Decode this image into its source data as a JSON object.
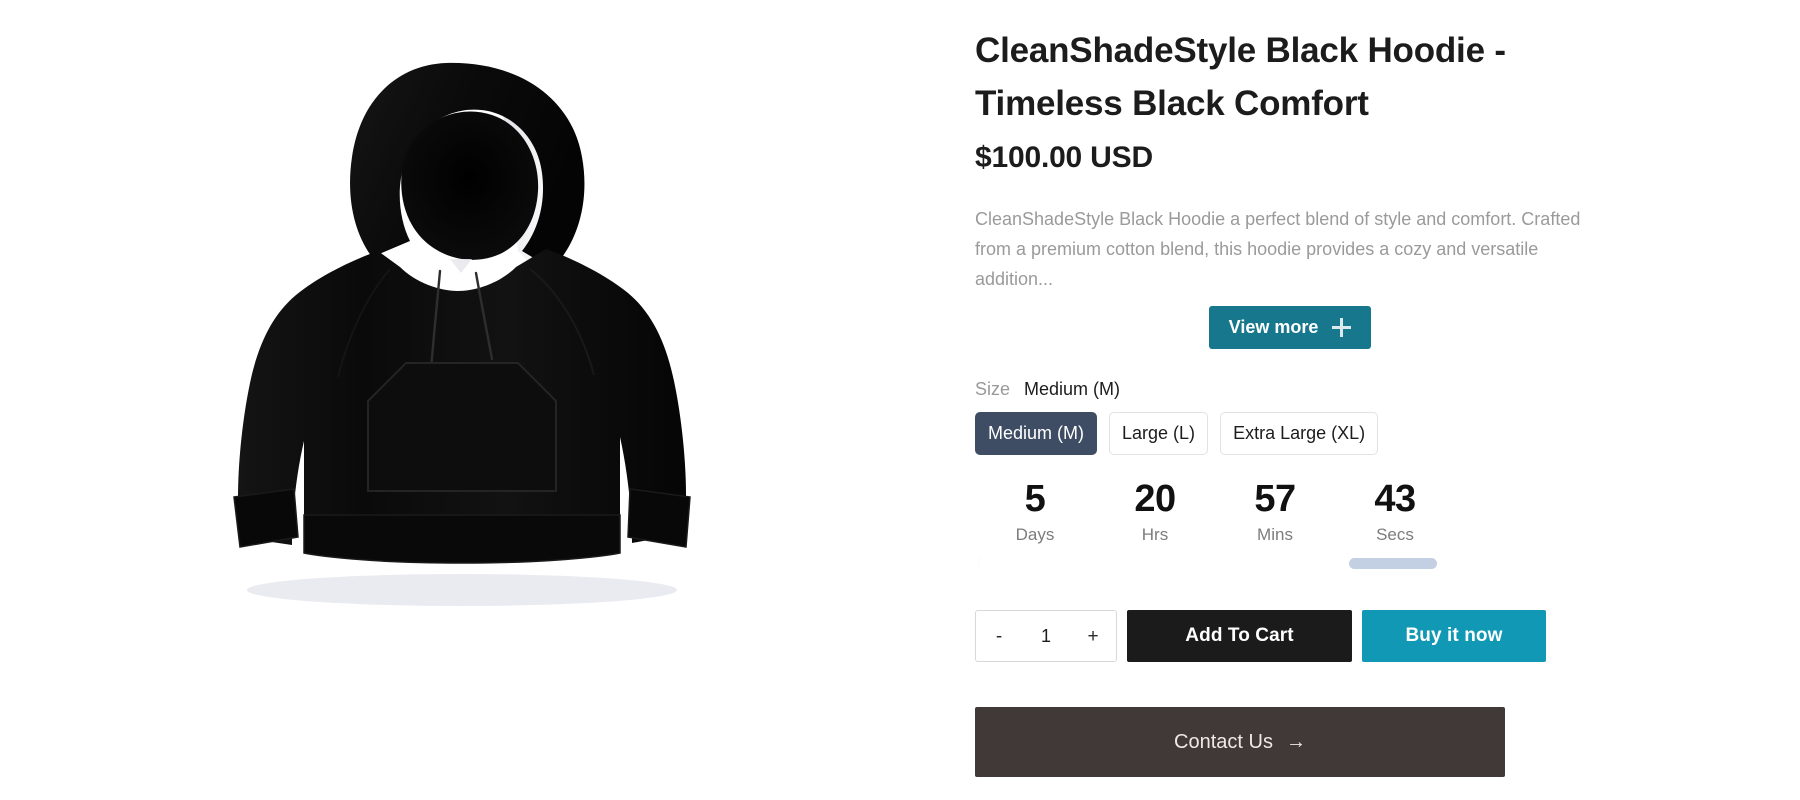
{
  "product": {
    "title": "CleanShadeStyle Black Hoodie - Timeless Black Comfort",
    "price": "$100.00 USD",
    "description": "CleanShadeStyle Black Hoodie a perfect blend of style and comfort. Crafted from a premium cotton blend, this hoodie provides a cozy and versatile addition...",
    "image_alt": "black-hoodie-product-photo"
  },
  "view_more": {
    "label": "View more",
    "icon": "plus-icon"
  },
  "size": {
    "legend_label": "Size",
    "selected_value": "Medium (M)",
    "options": [
      {
        "label": "Medium (M)",
        "selected": true
      },
      {
        "label": "Large (L)",
        "selected": false
      },
      {
        "label": "Extra Large (XL)",
        "selected": false
      }
    ]
  },
  "countdown": {
    "units": [
      {
        "value": "5",
        "label": "Days"
      },
      {
        "value": "20",
        "label": "Hrs"
      },
      {
        "value": "57",
        "label": "Mins"
      },
      {
        "value": "43",
        "label": "Secs"
      }
    ]
  },
  "quantity": {
    "decrement_label": "-",
    "value": "1",
    "increment_label": "+"
  },
  "actions": {
    "add_to_cart_label": "Add To Cart",
    "buy_now_label": "Buy it now",
    "contact_label": "Contact Us",
    "contact_arrow": "→"
  },
  "colors": {
    "view_more_bg": "#17788d",
    "size_selected_bg": "#3e4d63",
    "add_to_cart_bg": "#1b1b1b",
    "buy_now_bg": "#1098b4",
    "contact_bg": "#413838",
    "skeleton_bar": "#c3cfe2",
    "page_bg": "#ffffff",
    "title_color": "#1c1c1c",
    "muted_text": "#9a9a9a"
  }
}
